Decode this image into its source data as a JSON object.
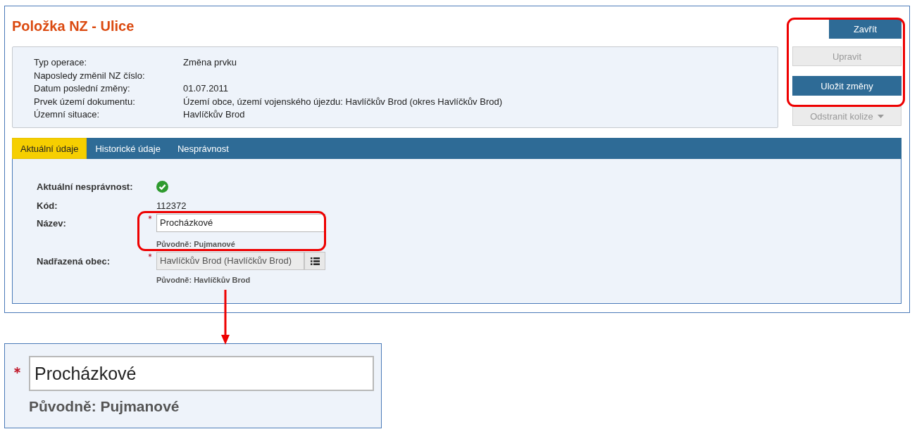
{
  "page": {
    "title": "Položka NZ - Ulice"
  },
  "info": [
    {
      "label": "Typ operace:",
      "value": "Změna prvku"
    },
    {
      "label": "Naposledy změnil NZ číslo:"
    },
    {
      "label": "Datum poslední změny:",
      "value": "01.07.2011"
    },
    {
      "label": "Prvek území dokumentu:",
      "value": "Území obce, území vojenského újezdu: Havlíčkův Brod (okres Havlíčkův Brod)"
    },
    {
      "label": "Územní situace:",
      "value": "Havlíčkův Brod"
    }
  ],
  "actions": [
    {
      "label": "Zavřít",
      "kind": "button",
      "disabled": false
    },
    {
      "label": "Upravit",
      "kind": "button",
      "disabled": true
    },
    {
      "label": "Uložit změny",
      "kind": "button",
      "disabled": false
    },
    {
      "label": "Odstranit kolize",
      "kind": "dropdown",
      "disabled": true
    }
  ],
  "tabs": [
    {
      "label": "Aktuální údaje",
      "selected": true
    },
    {
      "label": "Historické údaje",
      "selected": false
    },
    {
      "label": "Nesprávnost",
      "selected": false
    }
  ],
  "fields": [
    {
      "label": "Aktuální nesprávnost:",
      "kind": "status",
      "ok": true
    },
    {
      "label": "Kód:",
      "kind": "text",
      "value": "112372"
    },
    {
      "label": "Název:",
      "kind": "input",
      "required": true,
      "value": "Procházkové",
      "original": "Původně: Pujmanové"
    },
    {
      "label": "Nadřazená obec:",
      "kind": "picker",
      "required": true,
      "value": "Havlíčkův Brod (Havlíčkův Brod)",
      "original": "Původně: Havlíčkův Brod"
    }
  ],
  "callout": {
    "required": true,
    "value": "Procházkové",
    "original": "Původně: Pujmanové"
  }
}
